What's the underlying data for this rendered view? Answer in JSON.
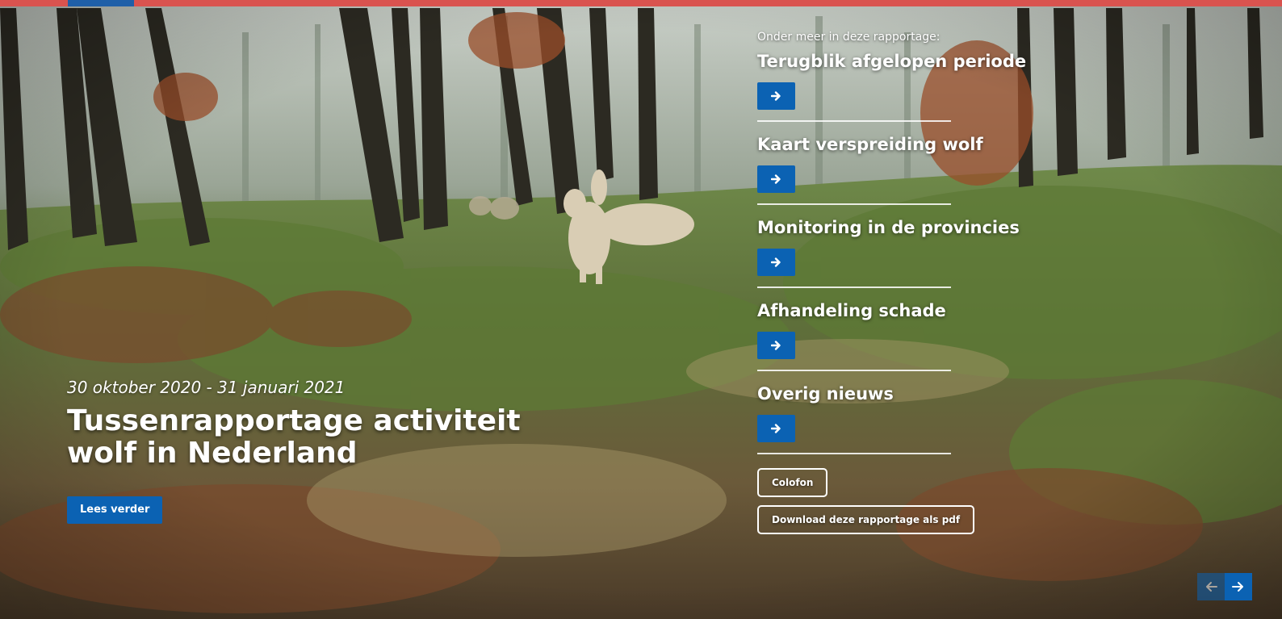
{
  "colors": {
    "top_bar": "#d9534f",
    "top_bar_accent": "#1f5fa8",
    "primary_button": "#0b62b3",
    "text": "#ffffff"
  },
  "hero": {
    "date_range": "30 oktober 2020 - 31 januari 2021",
    "title": "Tussenrapportage activiteit wolf in Nederland",
    "read_more_label": "Lees verder"
  },
  "nav": {
    "intro": "Onder meer in deze rapportage:",
    "items": [
      {
        "title": "Terugblik afgelopen periode",
        "arrow_icon": "arrow-right-icon"
      },
      {
        "title": "Kaart verspreiding wolf",
        "arrow_icon": "arrow-right-icon"
      },
      {
        "title": "Monitoring in de provincies",
        "arrow_icon": "arrow-right-icon"
      },
      {
        "title": "Afhandeling schade",
        "arrow_icon": "arrow-right-icon"
      },
      {
        "title": "Overig nieuws",
        "arrow_icon": "arrow-right-icon"
      }
    ],
    "colofon_label": "Colofon",
    "download_label": "Download deze rapportage als pdf"
  },
  "slider": {
    "prev_icon": "arrow-left-icon",
    "next_icon": "arrow-right-icon"
  }
}
